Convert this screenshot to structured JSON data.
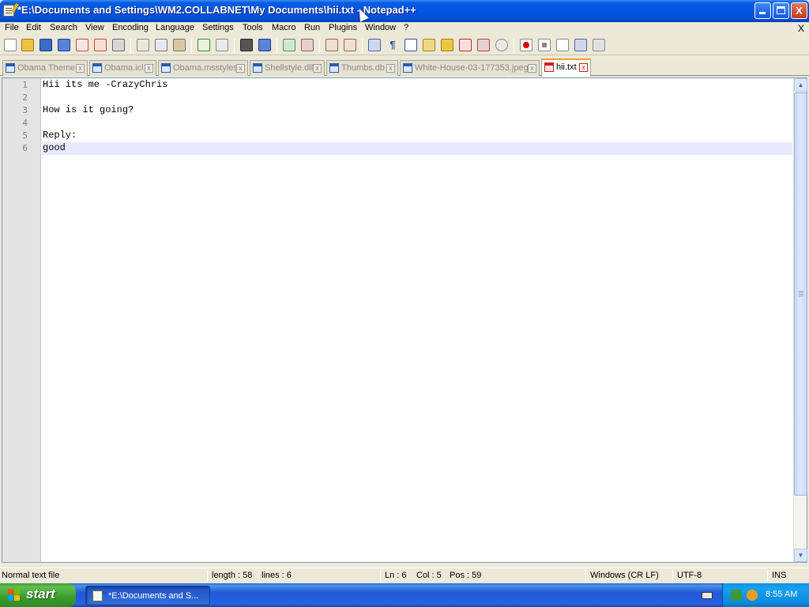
{
  "window": {
    "title": "*E:\\Documents and Settings\\WM2.COLLABNET\\My Documents\\hii.txt - Notepad++",
    "minimize_label": "",
    "maximize_label": "",
    "close_label": "X"
  },
  "menu": {
    "items": [
      "File",
      "Edit",
      "Search",
      "View",
      "Encoding",
      "Language",
      "Settings",
      "Tools",
      "Macro",
      "Run",
      "Plugins",
      "Window",
      "?"
    ],
    "close_doc_label": "X"
  },
  "toolbar": {
    "icons": [
      "new-file-icon",
      "open-file-icon",
      "save-icon",
      "save-all-icon",
      "close-icon",
      "close-all-icon",
      "print-icon",
      "cut-icon",
      "copy-icon",
      "paste-icon",
      "undo-icon",
      "redo-icon",
      "find-icon",
      "replace-icon",
      "zoom-in-icon",
      "zoom-out-icon",
      "sync-vertical-icon",
      "sync-horizontal-icon",
      "word-wrap-icon",
      "show-all-chars-icon",
      "indent-guide-icon",
      "language-icon",
      "function-list-icon",
      "folder-icon",
      "document-map-icon",
      "monitoring-icon",
      "record-macro-icon",
      "stop-macro-icon",
      "play-macro-icon",
      "run-macro-multiple-icon",
      "save-macro-icon"
    ]
  },
  "tabs": [
    {
      "label": "Obama Theme",
      "active": false
    },
    {
      "label": "Obama.icl",
      "active": false
    },
    {
      "label": "Obama.msstyles",
      "active": false
    },
    {
      "label": "Shellstyle.dll",
      "active": false
    },
    {
      "label": "Thumbs.db",
      "active": false
    },
    {
      "label": "White-House-03-177353.jpeg",
      "active": false
    },
    {
      "label": "hii.txt",
      "active": true
    }
  ],
  "editor": {
    "line_numbers": [
      "1",
      "2",
      "3",
      "4",
      "5",
      "6"
    ],
    "lines": [
      "Hii its me -CrazyChris",
      "",
      "How is it going?",
      "",
      "Reply:",
      "good"
    ],
    "current_line": 6
  },
  "status": {
    "file_type": "Normal text file",
    "length": "length : 58",
    "lines": "lines : 6",
    "ln": "Ln : 6",
    "col": "Col : 5",
    "pos": "Pos : 59",
    "eol": "Windows (CR LF)",
    "encoding": "UTF-8",
    "mode": "INS"
  },
  "taskbar": {
    "start_label": "start",
    "task_label": "*E:\\Documents and S...",
    "clock": "8:55 AM"
  },
  "colors": {
    "titlebar": "#0554e4",
    "current_line_highlight": "#e8e8ff",
    "active_tab_accent": "#f0a030",
    "start_button": "#3a9b2f"
  }
}
